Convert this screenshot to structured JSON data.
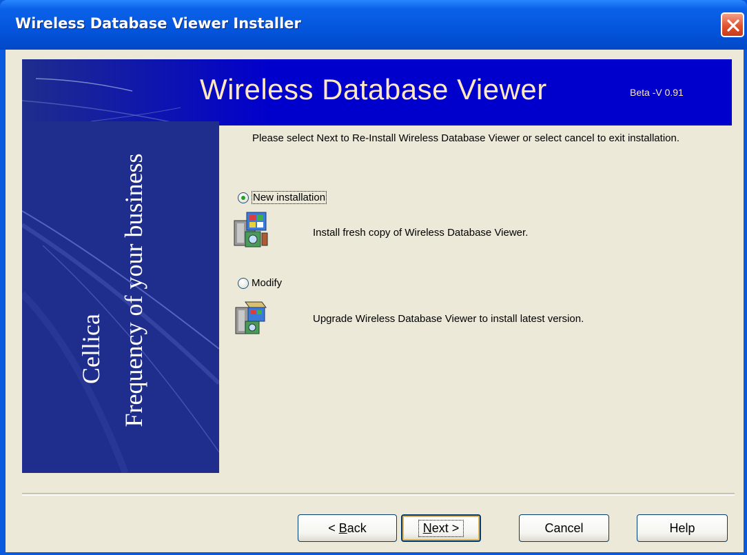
{
  "window": {
    "title": "Wireless Database Viewer Installer"
  },
  "banner": {
    "title": "Wireless Database Viewer",
    "version": "Beta -V 0.91"
  },
  "sidepanel": {
    "brand": "Cellica",
    "tagline": "Frequency of your business"
  },
  "main": {
    "instructions": "Please select Next to Re-Install Wireless Database Viewer or select cancel to exit installation.",
    "options": [
      {
        "label": "New installation",
        "description": "Install fresh copy of Wireless Database Viewer.",
        "selected": true,
        "icon": "install-package-icon"
      },
      {
        "label": "Modify",
        "description": "Upgrade Wireless Database Viewer to install latest version.",
        "selected": false,
        "icon": "modify-package-icon"
      }
    ]
  },
  "buttons": {
    "back_pre": "< ",
    "back_key": "B",
    "back_post": "ack",
    "next_key": "N",
    "next_post": "ext >",
    "cancel": "Cancel",
    "help": "Help"
  },
  "colors": {
    "titlebar": "#0455dc",
    "banner": "#0000cc",
    "sidepanel": "#1f2d8c",
    "dialog_bg": "#ece9d8",
    "close_button": "#e0542f"
  }
}
